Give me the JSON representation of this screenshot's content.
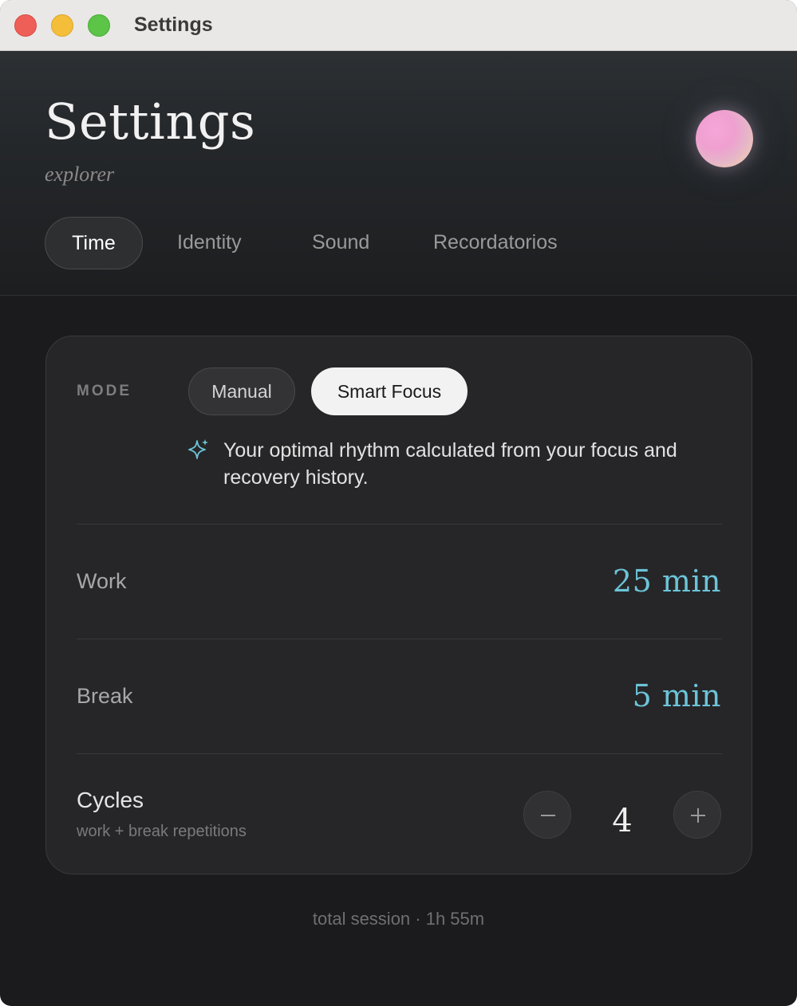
{
  "window": {
    "title": "Settings",
    "controls": [
      "close",
      "minimize",
      "maximize"
    ]
  },
  "header": {
    "title": "Settings",
    "subtitle": "explorer",
    "avatar_icon": "avatar-gradient-orb"
  },
  "tabs": [
    {
      "label": "Time",
      "active": true
    },
    {
      "label": "Identity",
      "active": false
    },
    {
      "label": "Sound",
      "active": false
    },
    {
      "label": "Recordatorios",
      "active": false
    }
  ],
  "mode": {
    "label": "MODE",
    "options": [
      {
        "label": "Manual",
        "selected": false
      },
      {
        "label": "Smart Focus",
        "selected": true
      }
    ],
    "hint_icon": "sparkle-icon",
    "hint": "Your optimal rhythm calculated from your focus and recovery history."
  },
  "work": {
    "label": "Work",
    "value": "25 min"
  },
  "break": {
    "label": "Break",
    "value": "5 min"
  },
  "cycles": {
    "label": "Cycles",
    "sublabel": "work + break repetitions",
    "value": "4",
    "decrement_icon": "minus-icon",
    "increment_icon": "plus-icon"
  },
  "footer": {
    "summary": "total session · 1h 55m"
  },
  "colors": {
    "accent": "#6cc4d8",
    "background": "#1b1b1d",
    "card": "#262628",
    "selected_pill": "#f2f2f2"
  }
}
